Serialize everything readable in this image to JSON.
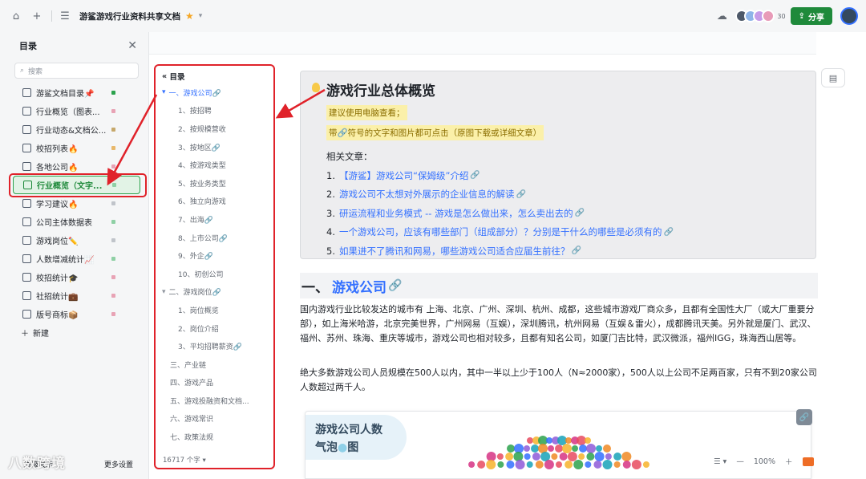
{
  "topbar": {
    "doc_title": "游鲨游戏行业资料共享文档",
    "avatar_count": "30",
    "share_label": "分享"
  },
  "sidebar": {
    "title": "目录",
    "search_placeholder": "搜索",
    "items": [
      {
        "label": "游鲨文档目录📌",
        "dot": "#2ba24c"
      },
      {
        "label": "行业概览（图表...",
        "dot": "#e8a3b5"
      },
      {
        "label": "行业动态&文档公...",
        "dot": "#c6a86b"
      },
      {
        "label": "校招列表🔥",
        "dot": "#e8b86b"
      },
      {
        "label": "各地公司🔥",
        "dot": "#e8a3b5"
      },
      {
        "label": "行业概览（文字...",
        "dot": "#8fd0a5",
        "active": true
      },
      {
        "label": "学习建议🔥",
        "dot": "#c0c4ca"
      },
      {
        "label": "公司主体数据表",
        "dot": "#8fd0a5"
      },
      {
        "label": "游戏岗位✏️",
        "dot": "#c0c4ca"
      },
      {
        "label": "人数增减统计📈",
        "dot": "#8fd0a5"
      },
      {
        "label": "校招统计🎓",
        "dot": "#e8a3b5"
      },
      {
        "label": "社招统计💼",
        "dot": "#e8a3b5"
      },
      {
        "label": "版号商标📦",
        "dot": "#e8a3b5"
      }
    ],
    "new_label": "新建",
    "bottom_left": "层级展示",
    "bottom_right": "更多设置"
  },
  "outline": {
    "title": "目录",
    "items": [
      {
        "label": "一、游戏公司🔗",
        "level": 1,
        "current": true,
        "arrow": "▾"
      },
      {
        "label": "1、按招聘",
        "level": 2
      },
      {
        "label": "2、按规模营收",
        "level": 2
      },
      {
        "label": "3、按地区🔗",
        "level": 2
      },
      {
        "label": "4、按游戏类型",
        "level": 2
      },
      {
        "label": "5、按业务类型",
        "level": 2
      },
      {
        "label": "6、独立向游戏",
        "level": 2
      },
      {
        "label": "7、出海🔗",
        "level": 2
      },
      {
        "label": "8、上市公司🔗",
        "level": 2
      },
      {
        "label": "9、外企🔗",
        "level": 2
      },
      {
        "label": "10、初创公司",
        "level": 2
      },
      {
        "label": "二、游戏岗位🔗",
        "level": 1,
        "arrow": "▾"
      },
      {
        "label": "1、岗位概览",
        "level": 2
      },
      {
        "label": "2、岗位介绍",
        "level": 2
      },
      {
        "label": "3、平均招聘薪资🔗",
        "level": 2
      },
      {
        "label": "三、产业链",
        "level": 1
      },
      {
        "label": "四、游戏产品",
        "level": 1
      },
      {
        "label": "五、游戏投融资和文档...",
        "level": 1
      },
      {
        "label": "六、游戏常识",
        "level": 1
      },
      {
        "label": "七、政策法规",
        "level": 1
      }
    ],
    "word_count": "16717 个字"
  },
  "doc": {
    "callout_title": "游戏行业总体概览",
    "highlight_1": "建议使用电脑查看；",
    "highlight_2": "带🔗符号的文字和图片都可点击（原图下载或详细文章）",
    "related_title": "相关文章：",
    "related": [
      {
        "num": "1.",
        "text": "【游鲨】游戏公司“保姆级”介绍"
      },
      {
        "num": "2.",
        "text": "游戏公司不太想对外展示的企业信息的解读"
      },
      {
        "num": "3.",
        "text": "研运流程和业务模式 -- 游戏是怎么做出来，怎么卖出去的"
      },
      {
        "num": "4.",
        "text": "一个游戏公司，应该有哪些部门（组成部分）？分别是干什么的哪些是必须有的"
      },
      {
        "num": "5.",
        "text": "如果进不了腾讯和网易，哪些游戏公司适合应届生前往？"
      }
    ],
    "h1_prefix": "一、",
    "h1_link": "游戏公司",
    "para_1": "国内游戏行业比较发达的城市有 上海、北京、广州、深圳、杭州、成都，这些城市游戏厂商众多，且都有全国性大厂（或大厂重要分部），如上海米哈游，北京完美世界，广州网易（互娱），深圳腾讯，杭州网易（互娱＆雷火），成都腾讯天美。另外就是厦门、武汉、福州、苏州、珠海、重庆等城市，游戏公司也相对较多，且都有知名公司，如厦门吉比特，武汉微派，福州IGG，珠海西山居等。",
    "para_2": "绝大多数游戏公司人员规模在500人以内，其中一半以上少于100人（N≈2000家），500人以上公司不足两百家，只有不到20家公司人数超过两千人。",
    "image_title_1": "游戏公司人数",
    "image_title_2": "气泡",
    "image_title_3": "图"
  },
  "zoom": {
    "level": "100%"
  },
  "watermark": "八数跨境"
}
